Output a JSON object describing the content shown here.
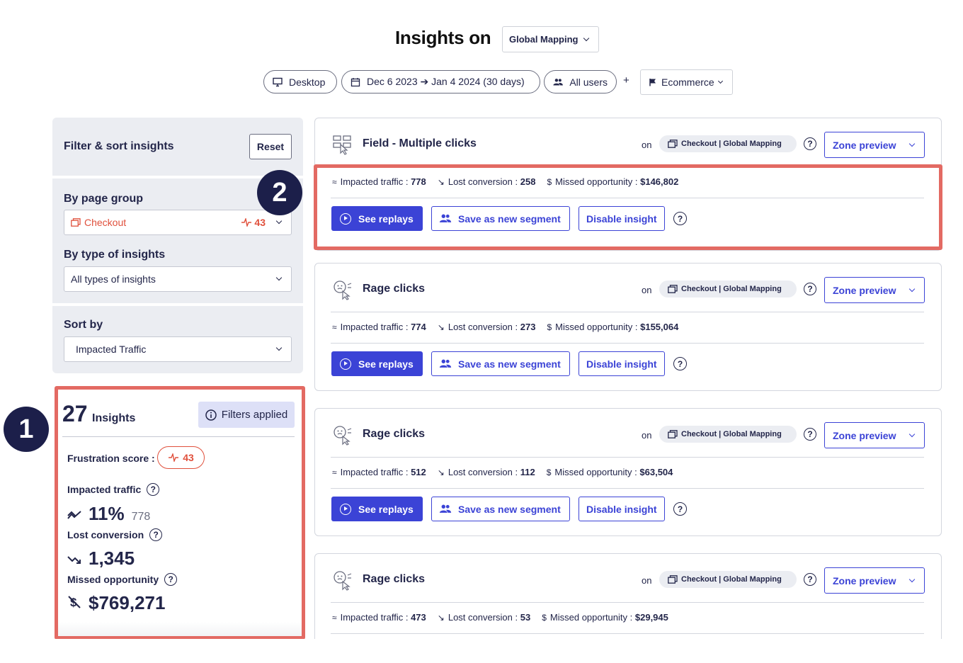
{
  "header": {
    "title": "Insights on",
    "mapping": "Global Mapping",
    "device": "Desktop",
    "date_range": "Dec 6 2023 ➔ Jan 4 2024 (30 days)",
    "audience": "All users",
    "plus": "+",
    "goal": "Ecommerce"
  },
  "sidebar": {
    "filter_title": "Filter & sort insights",
    "reset_label": "Reset",
    "page_group_label": "By page group",
    "page_group_value": "Checkout",
    "page_group_score": "43",
    "type_label": "By type of insights",
    "type_value": "All types of insights",
    "sort_label": "Sort by",
    "sort_value": "Impacted Traffic"
  },
  "callouts": {
    "one": "1",
    "two": "2"
  },
  "summary": {
    "count": "27",
    "count_label": "Insights",
    "filters_applied": "Filters applied",
    "frustration_label": "Frustration score :",
    "frustration_value": "43",
    "impacted_label": "Impacted traffic",
    "impacted_pct": "11%",
    "impacted_count": "778",
    "lost_label": "Lost conversion",
    "lost_value": "1,345",
    "missed_label": "Missed opportunity",
    "missed_value": "$769,271"
  },
  "cards": [
    {
      "title": "Field - Multiple clicks",
      "on": "on",
      "page": "Checkout | Global Mapping",
      "zone": "Zone preview",
      "impacted_label": "Impacted traffic :",
      "impacted": "778",
      "lost_label": "Lost conversion :",
      "lost": "258",
      "missed_label": "Missed opportunity :",
      "missed": "$146,802",
      "replays": "See replays",
      "segment": "Save as new segment",
      "disable": "Disable insight"
    },
    {
      "title": "Rage clicks",
      "on": "on",
      "page": "Checkout | Global Mapping",
      "zone": "Zone preview",
      "impacted_label": "Impacted traffic :",
      "impacted": "774",
      "lost_label": "Lost conversion :",
      "lost": "273",
      "missed_label": "Missed opportunity :",
      "missed": "$155,064",
      "replays": "See replays",
      "segment": "Save as new segment",
      "disable": "Disable insight"
    },
    {
      "title": "Rage clicks",
      "on": "on",
      "page": "Checkout | Global Mapping",
      "zone": "Zone preview",
      "impacted_label": "Impacted traffic :",
      "impacted": "512",
      "lost_label": "Lost conversion :",
      "lost": "112",
      "missed_label": "Missed opportunity :",
      "missed": "$63,504",
      "replays": "See replays",
      "segment": "Save as new segment",
      "disable": "Disable insight"
    },
    {
      "title": "Rage clicks",
      "on": "on",
      "page": "Checkout | Global Mapping",
      "zone": "Zone preview",
      "impacted_label": "Impacted traffic :",
      "impacted": "473",
      "lost_label": "Lost conversion :",
      "lost": "53",
      "missed_label": "Missed opportunity :",
      "missed": "$29,945"
    }
  ],
  "colors": {
    "accent": "#3b43d6",
    "navy": "#23264a",
    "alert": "#e0503c",
    "highlight": "#e36a63"
  }
}
